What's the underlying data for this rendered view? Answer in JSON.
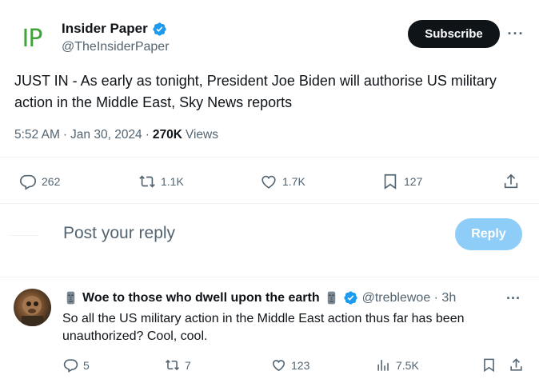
{
  "tweet": {
    "logo_text": "IP",
    "author_name": "Insider Paper",
    "handle": "@TheInsiderPaper",
    "subscribe_label": "Subscribe",
    "more_label": "···",
    "text": "JUST IN - As early as tonight, President Joe Biden will authorise US military action in the Middle East, Sky News reports",
    "time": "5:52 AM",
    "separator": "·",
    "date": "Jan 30, 2024",
    "views_count": "270K",
    "views_label": "Views",
    "stats": {
      "replies": "262",
      "reposts": "1.1K",
      "likes": "1.7K",
      "bookmarks": "127"
    }
  },
  "composer": {
    "placeholder": "Post your reply",
    "reply_label": "Reply"
  },
  "reply": {
    "name": "Woe to those who dwell upon the earth",
    "handle_time": "@treblewoe · 3h",
    "more_label": "···",
    "text": "So all the US military action in the Middle East action thus far has been unauthorized? Cool, cool.",
    "stats": {
      "replies": "5",
      "reposts": "7",
      "likes": "123",
      "views": "7.5K"
    }
  },
  "colors": {
    "verified": "#1d9bf0",
    "reply_button": "#8ecdf8",
    "secondary_text": "#536471",
    "logo_green": "#3fa33a"
  }
}
